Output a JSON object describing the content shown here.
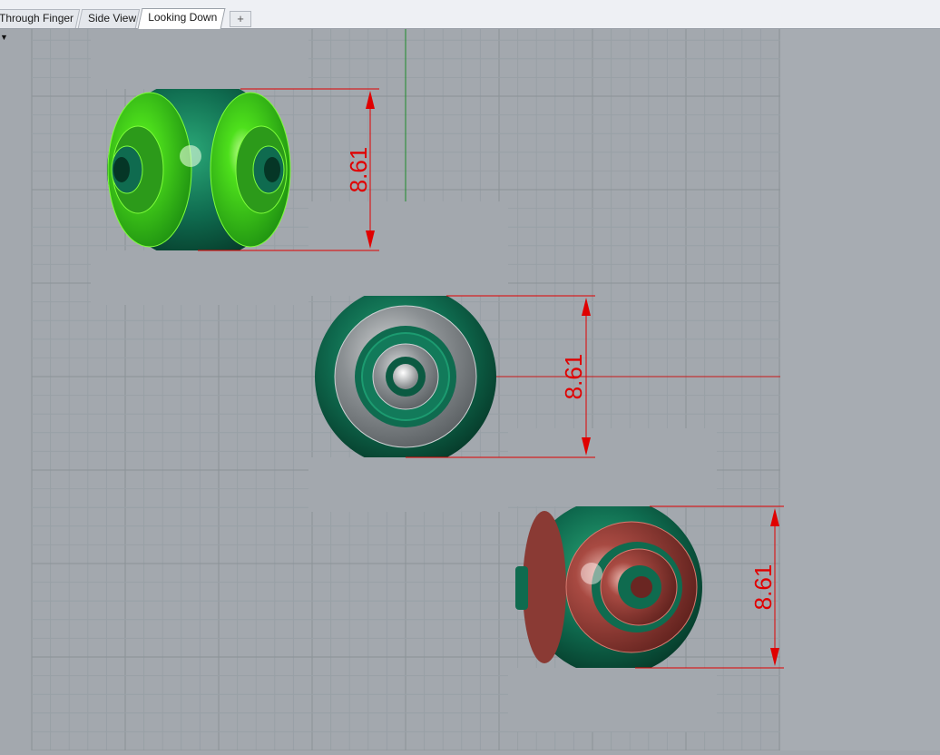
{
  "tabs": [
    {
      "label": "Through Finger",
      "active": false
    },
    {
      "label": "Side View",
      "active": false
    },
    {
      "label": "Looking Down",
      "active": true
    }
  ],
  "add_tab_label": "+",
  "viewport": {
    "menu_icon": "dropdown-arrow-icon",
    "dimensions": [
      {
        "value": "8.61"
      },
      {
        "value": "8.61"
      },
      {
        "value": "8.61"
      }
    ]
  },
  "colors": {
    "viewport_bg": "#a3a8ae",
    "grid_minor": "#98a0a6",
    "grid_major": "#8b9297",
    "dimension": "#e00000",
    "axis_green": "#1e8c2a",
    "axis_red": "#c81818",
    "body_green": "#0f6b4f",
    "highlight_green": "#33d21a",
    "highlight_gray": "#8a8f92",
    "highlight_red": "#a84a42"
  }
}
